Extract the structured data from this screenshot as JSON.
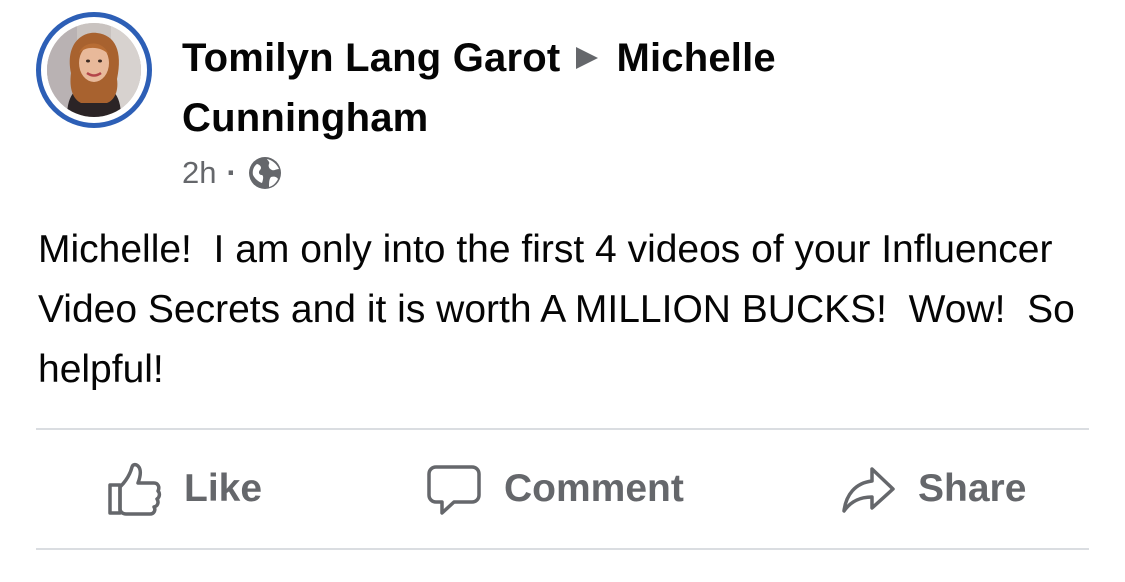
{
  "post": {
    "author": "Tomilyn Lang Garot",
    "recipient_line1": "Michelle",
    "recipient_line2": "Cunningham",
    "timestamp": "2h",
    "separator": "·",
    "privacy_icon": "globe-icon",
    "text": "Michelle!  I am only into the first 4 videos of your Influencer Video Secrets and it is worth A MILLION BUCKS!  Wow!  So helpful!"
  },
  "actions": {
    "like_label": "Like",
    "comment_label": "Comment",
    "share_label": "Share"
  },
  "colors": {
    "avatar_ring": "#2d5fb6",
    "secondary_text": "#65676b",
    "divider": "#dadde1"
  }
}
